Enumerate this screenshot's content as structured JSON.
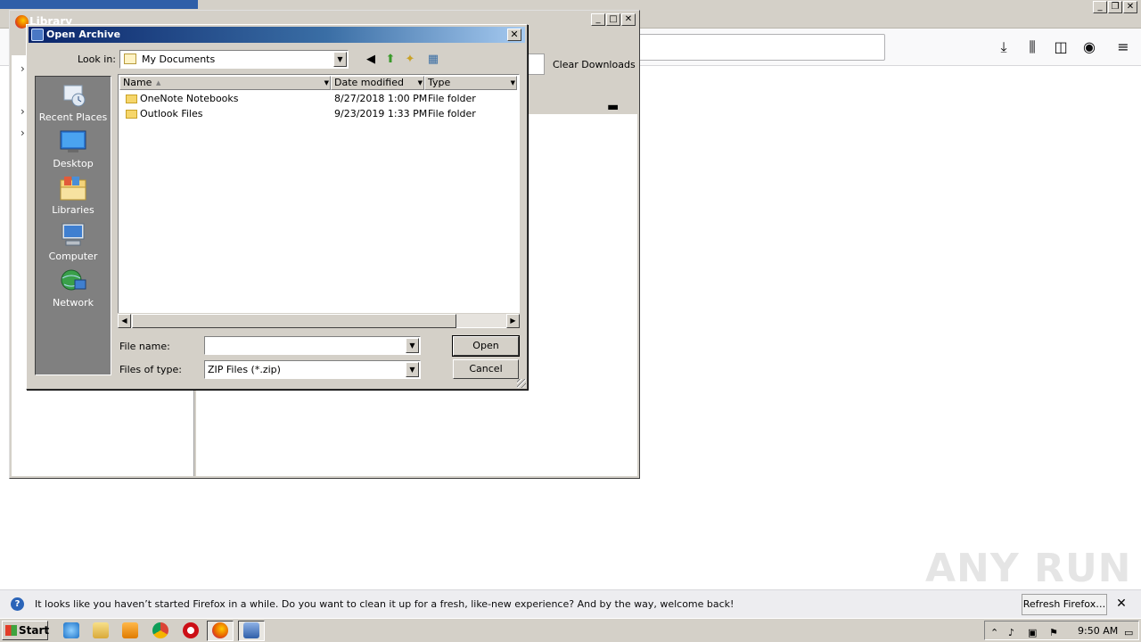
{
  "firefox": {
    "toolbar_icons": [
      "download-icon",
      "library-icon",
      "sidebar-icon",
      "account-icon",
      "menu-icon"
    ]
  },
  "library": {
    "title": "Library",
    "clear_downloads": "Clear Downloads"
  },
  "dialog": {
    "title": "Open Archive",
    "close_glyph": "✕",
    "look_in_label": "Look in:",
    "look_in_value": "My Documents",
    "places": [
      {
        "label": "Recent Places",
        "icon": "recent-places-icon"
      },
      {
        "label": "Desktop",
        "icon": "desktop-icon"
      },
      {
        "label": "Libraries",
        "icon": "libraries-icon"
      },
      {
        "label": "Computer",
        "icon": "computer-icon"
      },
      {
        "label": "Network",
        "icon": "network-icon"
      }
    ],
    "columns": {
      "name": "Name",
      "date": "Date modified",
      "type": "Type"
    },
    "files": [
      {
        "name": "OneNote Notebooks",
        "date": "8/27/2018 1:00 PM",
        "type": "File folder"
      },
      {
        "name": "Outlook Files",
        "date": "9/23/2019 1:33 PM",
        "type": "File folder"
      }
    ],
    "file_name_label": "File name:",
    "file_name_value": "",
    "files_of_type_label": "Files of type:",
    "files_of_type_value": "ZIP Files (*.zip)",
    "open_label": "Open",
    "cancel_label": "Cancel"
  },
  "notification": {
    "message": "It looks like you haven’t started Firefox in a while. Do you want to clean it up for a fresh, like-new experience? And by the way, welcome back!",
    "button_label": "Refresh Firefox…"
  },
  "watermark": "ANY RUN",
  "taskbar": {
    "start_label": "Start",
    "clock": "9:50 AM",
    "pinned": [
      "ie-icon",
      "explorer-icon",
      "media-player-icon",
      "chrome-icon",
      "opera-icon",
      "firefox-icon",
      "archiver-icon"
    ]
  },
  "colors": {
    "dialog_title_start": "#0a246a",
    "dialog_title_end": "#a6caf0",
    "window_face": "#d4d0c8",
    "notification_bg": "#ededf0"
  }
}
